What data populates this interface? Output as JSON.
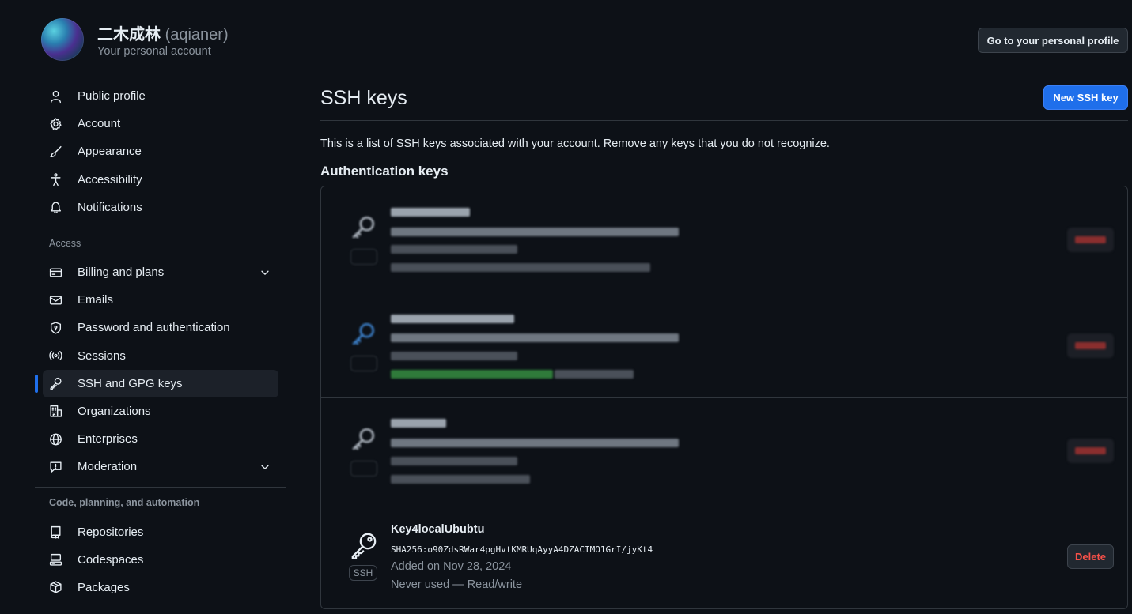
{
  "header": {
    "account_name": "二木成林",
    "account_handle": "(aqianer)",
    "account_subtitle": "Your personal account",
    "profile_button": "Go to your personal profile"
  },
  "sidebar": {
    "top_items": [
      {
        "label": "Public profile",
        "icon": "person-icon"
      },
      {
        "label": "Account",
        "icon": "gear-icon"
      },
      {
        "label": "Appearance",
        "icon": "paintbrush-icon"
      },
      {
        "label": "Accessibility",
        "icon": "accessibility-icon"
      },
      {
        "label": "Notifications",
        "icon": "bell-icon"
      }
    ],
    "access_heading": "Access",
    "access_items": [
      {
        "label": "Billing and plans",
        "icon": "credit-card-icon",
        "expandable": true
      },
      {
        "label": "Emails",
        "icon": "mail-icon"
      },
      {
        "label": "Password and authentication",
        "icon": "shield-lock-icon"
      },
      {
        "label": "Sessions",
        "icon": "broadcast-icon"
      },
      {
        "label": "SSH and GPG keys",
        "icon": "key-icon",
        "active": true
      },
      {
        "label": "Organizations",
        "icon": "organization-icon"
      },
      {
        "label": "Enterprises",
        "icon": "globe-icon"
      },
      {
        "label": "Moderation",
        "icon": "report-icon",
        "expandable": true
      }
    ],
    "code_heading": "Code, planning, and automation",
    "code_items": [
      {
        "label": "Repositories",
        "icon": "repo-icon"
      },
      {
        "label": "Codespaces",
        "icon": "codespaces-icon"
      },
      {
        "label": "Packages",
        "icon": "package-icon"
      }
    ]
  },
  "main": {
    "title": "SSH keys",
    "new_key_button": "New SSH key",
    "intro": "This is a list of SSH keys associated with your account. Remove any keys that you do not recognize.",
    "section_title": "Authentication keys",
    "visible_key": {
      "title": "Key4localUbubtu",
      "fingerprint": "SHA256:o90ZdsRWar4pgHvtKMRUqAyyA4DZACIMO1GrI/jyKt4",
      "added": "Added on Nov 28, 2024",
      "usage": "Never used — Read/write",
      "badge": "SSH",
      "delete_label": "Delete"
    }
  },
  "colors": {
    "background": "#0d1117",
    "accent": "#1f6feb",
    "danger": "#f85149",
    "muted_text": "#8b949e",
    "border": "#30363d"
  }
}
